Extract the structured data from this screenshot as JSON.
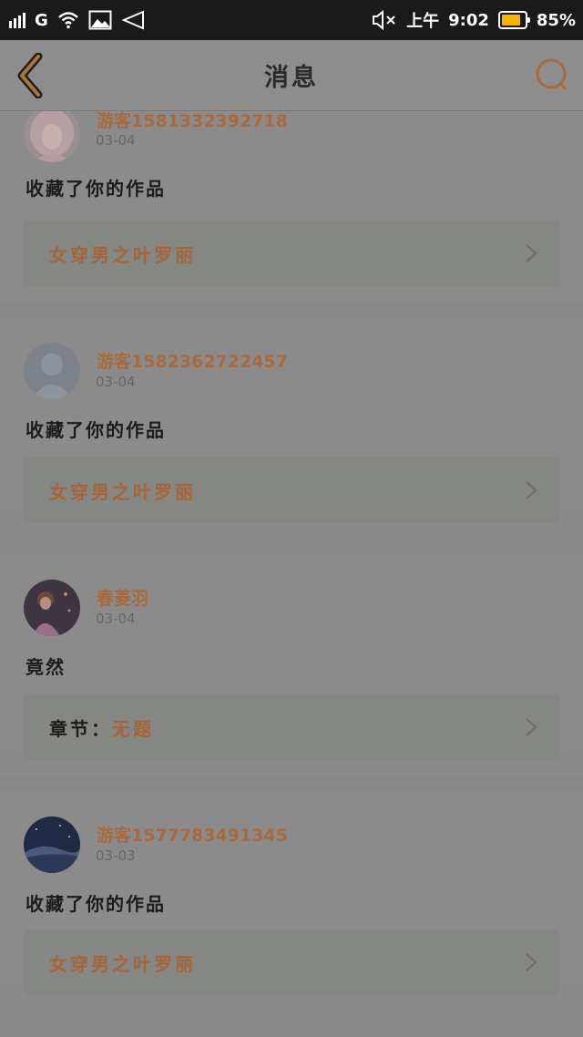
{
  "status_bar": {
    "carrier": "G",
    "time": "9:02",
    "ampm": "上午",
    "battery": "85%",
    "battery_level": 0.85
  },
  "nav": {
    "title": "消息",
    "back_icon": "chevron-left-icon",
    "search_icon": "search-icon"
  },
  "messages": [
    {
      "user": "游客1581332392718",
      "date": "03-04",
      "text": "收藏了你的作品",
      "work": "女穿男之叶罗丽",
      "avatar": "girl-pink"
    },
    {
      "user": "游客1582362722457",
      "date": "03-04",
      "text": "收藏了你的作品",
      "work": "女穿男之叶罗丽",
      "avatar": "default-person"
    },
    {
      "user": "春菱羽",
      "date": "03-04",
      "text": "竟然",
      "chapter_label": "章节：",
      "work": "无题",
      "avatar": "girl-dress"
    },
    {
      "user": "游客1577783491345",
      "date": "03-03",
      "text": "收藏了你的作品",
      "work": "女穿男之叶罗丽",
      "avatar": "night-sky"
    }
  ],
  "colors": {
    "accent": "#a86a3c",
    "overlay_bg": "#8b8b8b",
    "status_bar": "#1a1a1a"
  }
}
